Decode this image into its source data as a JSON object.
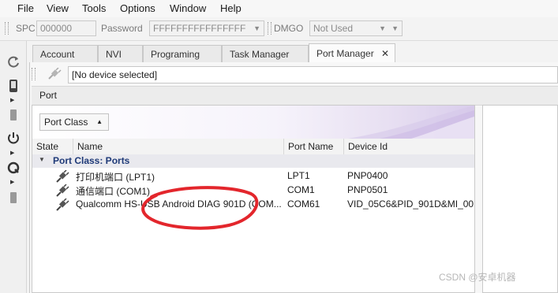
{
  "menu": [
    "File",
    "View",
    "Tools",
    "Options",
    "Window",
    "Help"
  ],
  "toolbar": {
    "spc_label": "SPC",
    "spc_value": "000000",
    "password_label": "Password",
    "password_value": "FFFFFFFFFFFFFFFF",
    "dmgo_label": "DMGO",
    "dmgo_value": "Not Used"
  },
  "sidebar_icons": [
    "refresh-icon",
    "phone-icon",
    "phone-grey-icon",
    "power-icon",
    "qualcomm-icon",
    "device-grey-icon"
  ],
  "tabs": [
    {
      "label": "Account",
      "active": false
    },
    {
      "label": "NVI",
      "active": false
    },
    {
      "label": "Programing",
      "active": false
    },
    {
      "label": "Task Manager",
      "active": false
    },
    {
      "label": "Port Manager",
      "active": true,
      "close": "✕"
    }
  ],
  "device": {
    "selected": "[No device selected]"
  },
  "port_section": {
    "title": "Port"
  },
  "port_class_button": "Port Class",
  "columns": [
    "State",
    "Name",
    "Port Name",
    "Device Id"
  ],
  "group": {
    "label": "Port Class: Ports"
  },
  "rows": [
    {
      "name": "打印机端口 (LPT1)",
      "port": "LPT1",
      "device_id": "PNP0400"
    },
    {
      "name": "通信端口 (COM1)",
      "port": "COM1",
      "device_id": "PNP0501"
    },
    {
      "name": "Qualcomm HS-USB Android DIAG 901D (COM...",
      "port": "COM61",
      "device_id": "VID_05C6&PID_901D&MI_00"
    }
  ],
  "watermark": "CSDN @安卓机器",
  "colors": {
    "annotation_red": "#e3262c",
    "group_text": "#1f3a78"
  }
}
